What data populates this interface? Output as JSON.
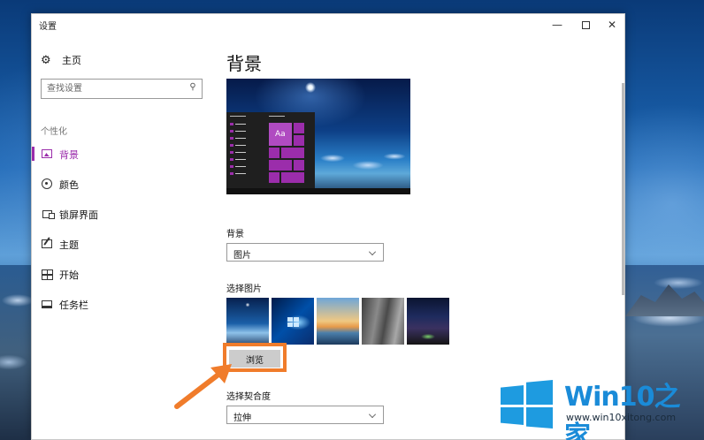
{
  "window": {
    "title": "设置",
    "controls": {
      "minimize": "—",
      "close": "✕"
    }
  },
  "sidebar": {
    "home_label": "主页",
    "search_placeholder": "查找设置",
    "section_label": "个性化",
    "items": [
      {
        "label": "背景",
        "icon": "picture-icon",
        "active": true
      },
      {
        "label": "颜色",
        "icon": "palette-icon",
        "active": false
      },
      {
        "label": "锁屏界面",
        "icon": "lock-screen-icon",
        "active": false
      },
      {
        "label": "主题",
        "icon": "theme-icon",
        "active": false
      },
      {
        "label": "开始",
        "icon": "start-icon",
        "active": false
      },
      {
        "label": "任务栏",
        "icon": "taskbar-icon",
        "active": false
      }
    ]
  },
  "main": {
    "page_title": "背景",
    "preview": {
      "tile_text": "Aa"
    },
    "background_label": "背景",
    "background_value": "图片",
    "choose_picture_label": "选择图片",
    "thumbnail_count": 5,
    "browse_label": "浏览",
    "fit_label": "选择契合度",
    "fit_value": "拉伸"
  },
  "watermark": {
    "brand_prefix": "Win10",
    "brand_suffix": "之家",
    "url": "www.win10xitong.com"
  },
  "colors": {
    "accent": "#9b2dab",
    "highlight": "#f07c2b",
    "brand": "#1a8bd8"
  }
}
